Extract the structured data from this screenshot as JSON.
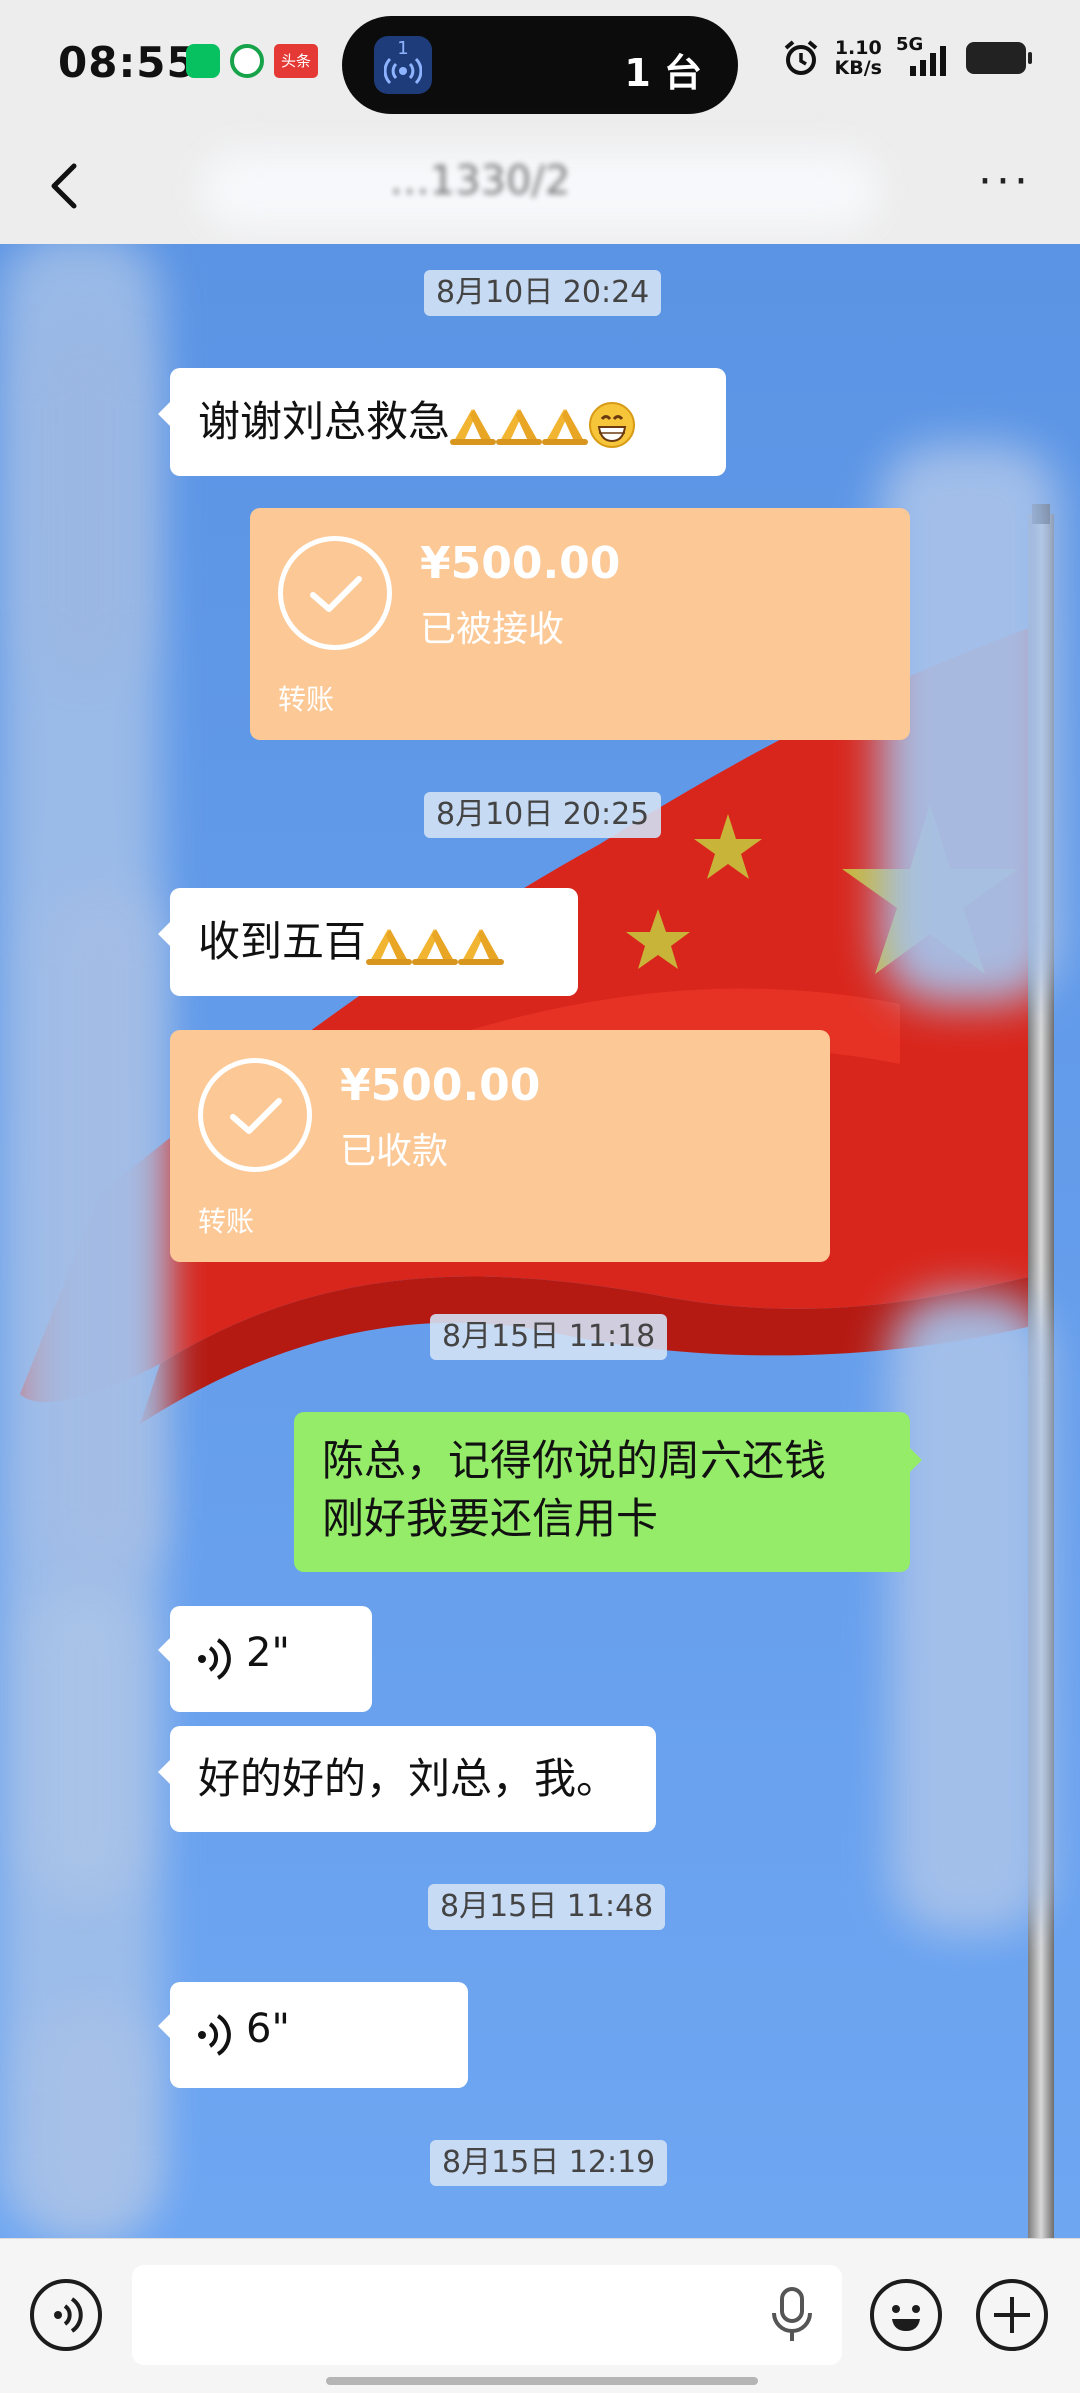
{
  "status_bar": {
    "time": "08:55",
    "toutiao_label": "头条",
    "broadcast_number": "1",
    "broadcast_count": "1 台",
    "net_rate": "1.10",
    "net_unit": "KB/s",
    "network": "5G"
  },
  "nav": {
    "title": "…1330/2"
  },
  "messages": [
    {
      "type": "timestamp",
      "text": "8月10日 20:24"
    },
    {
      "type": "text",
      "side": "left",
      "text": "谢谢刘总救急",
      "emoji": [
        "pray",
        "pray",
        "pray",
        "grin"
      ]
    },
    {
      "type": "transfer",
      "side": "right",
      "amount": "¥500.00",
      "status": "已被接收",
      "label": "转账"
    },
    {
      "type": "timestamp",
      "text": "8月10日 20:25"
    },
    {
      "type": "text",
      "side": "left",
      "text": "收到五百",
      "emoji": [
        "pray",
        "pray",
        "pray"
      ]
    },
    {
      "type": "transfer",
      "side": "left",
      "amount": "¥500.00",
      "status": "已收款",
      "label": "转账"
    },
    {
      "type": "timestamp",
      "text": "8月15日 11:18"
    },
    {
      "type": "text",
      "side": "right",
      "line1": "陈总，记得你说的周六还钱",
      "line2": "刚好我要还信用卡"
    },
    {
      "type": "voice",
      "side": "left",
      "duration": "2\""
    },
    {
      "type": "text",
      "side": "left",
      "text": "好的好的，刘总，我。"
    },
    {
      "type": "timestamp",
      "text": "8月15日 11:48"
    },
    {
      "type": "voice",
      "side": "left",
      "duration": "6\""
    },
    {
      "type": "timestamp",
      "text": "8月15日 12:19"
    }
  ],
  "input_bar": {
    "placeholder": "",
    "icons": [
      "voice-toggle-icon",
      "microphone-icon",
      "emoji-icon",
      "plus-icon"
    ]
  },
  "colors": {
    "chat_bg": "#5e97e6",
    "self_bubble": "#95ec69",
    "transfer_card": "#fbc896"
  }
}
